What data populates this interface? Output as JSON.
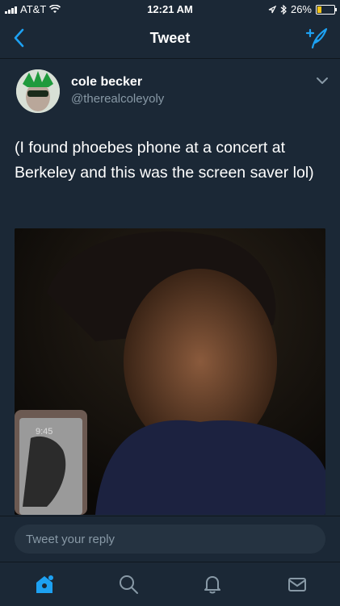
{
  "status_bar": {
    "carrier": "AT&T",
    "time": "12:21 AM",
    "battery": "26%",
    "battery_level": 0.26
  },
  "nav": {
    "title": "Tweet"
  },
  "tweet": {
    "author_name": "cole becker",
    "author_handle": "@therealcoleyoly",
    "text": "(I found phoebes phone at a concert at Berkeley and this was the screen saver lol)",
    "media": {
      "phone_time": "9:45"
    }
  },
  "reply": {
    "placeholder": "Tweet your reply"
  },
  "tabs": [
    "home",
    "search",
    "notifications",
    "messages"
  ],
  "colors": {
    "accent": "#1da1f2",
    "background": "#1b2836",
    "muted": "#8899a6"
  }
}
